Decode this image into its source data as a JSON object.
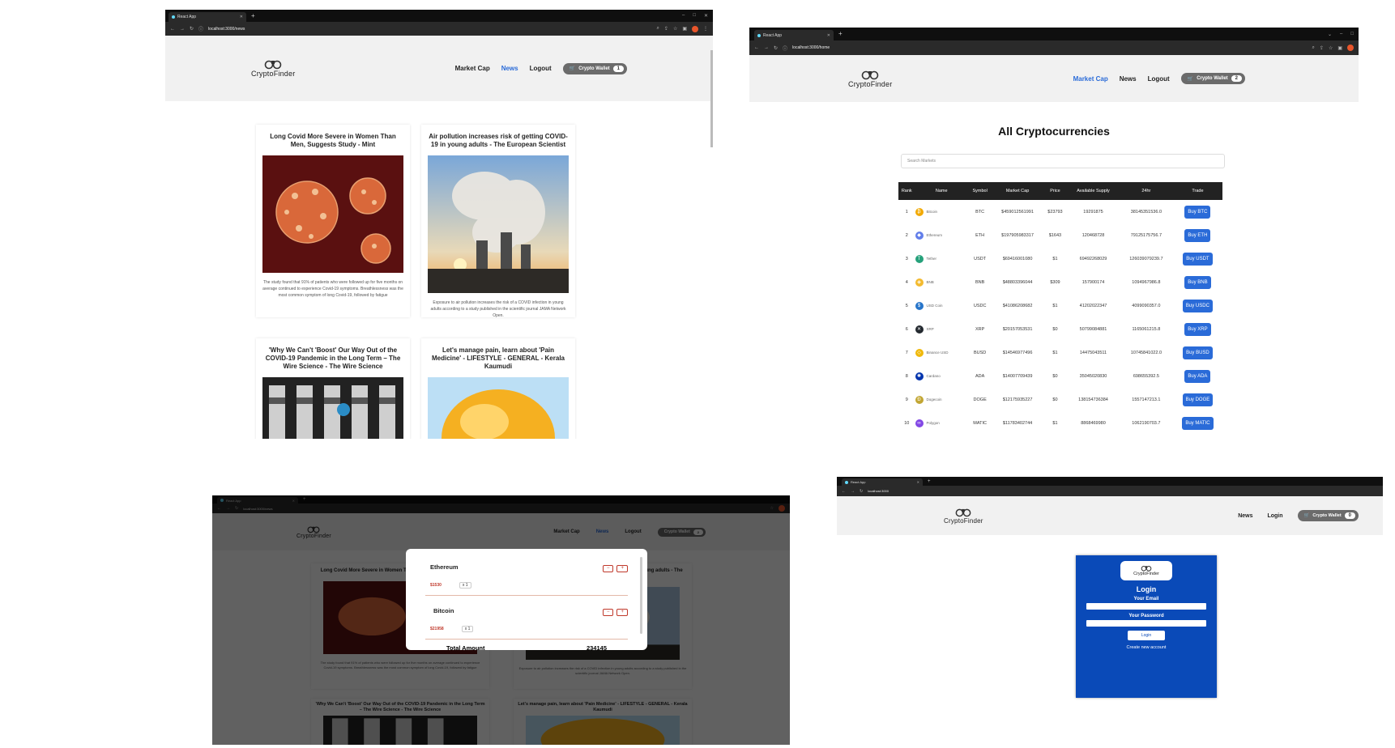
{
  "browser": {
    "tab_title": "React App",
    "news_url": "localhost:3000/news",
    "home_url": "localhost:3000/home",
    "login_url": "localhost:3000"
  },
  "brand": {
    "name": "CryptoFinder"
  },
  "nav": {
    "market_cap": "Market Cap",
    "news": "News",
    "logout": "Logout",
    "login": "Login",
    "wallet_label": "Crypto Wallet"
  },
  "wallet_counts": {
    "news": "1",
    "markets": "2",
    "login": "0"
  },
  "news": [
    {
      "title": "Long Covid More Severe in Women Than Men, Suggests Study - Mint",
      "desc": "The study found that 91% of patients who were followed up for five months on average continued to experience Covid-19 symptoms. Breathlessness was the most common symptom of long Covid-19, followed by fatigue"
    },
    {
      "title": "Air pollution increases risk of getting COVID-19 in young adults - The European Scientist",
      "desc": "Exposure to air pollution increases the risk of a COVID infection in young adults according to a study published in the scientific journal JAMA Network Open."
    },
    {
      "title": "'Why We Can't 'Boost' Our Way Out of the COVID-19 Pandemic in the Long Term – The Wire Science - The Wire Science",
      "desc": ""
    },
    {
      "title": "Let's manage pain, learn about 'Pain Medicine' - LIFESTYLE - GENERAL - Kerala Kaumudi",
      "desc": ""
    }
  ],
  "markets": {
    "title": "All Cryptocurrencies",
    "search_placeholder": "Search Markets",
    "headers": [
      "Rank",
      "Name",
      "Symbol",
      "Market Cap",
      "Price",
      "Available Supply",
      "24hr",
      "Trade"
    ],
    "rows": [
      {
        "rank": "1",
        "name": "Bitcoin",
        "symbol": "BTC",
        "cap": "$459012561991",
        "price": "$23793",
        "supply": "19291875",
        "vol": "38145351536.0",
        "trade": "Buy BTC",
        "color": "#f2a900",
        "glyph": "₿"
      },
      {
        "rank": "2",
        "name": "Ethereum",
        "symbol": "ETH",
        "cap": "$197905983317",
        "price": "$1643",
        "supply": "120468728",
        "vol": "79125175756.7",
        "trade": "Buy ETH",
        "color": "#627eea",
        "glyph": "◆"
      },
      {
        "rank": "3",
        "name": "Tether",
        "symbol": "USDT",
        "cap": "$69416001080",
        "price": "$1",
        "supply": "69492268029",
        "vol": "126039079239.7",
        "trade": "Buy USDT",
        "color": "#26a17b",
        "glyph": "T"
      },
      {
        "rank": "4",
        "name": "BNB",
        "symbol": "BNB",
        "cap": "$48803396044",
        "price": "$309",
        "supply": "157900174",
        "vol": "1094967986.8",
        "trade": "Buy BNB",
        "color": "#f3ba2f",
        "glyph": "◈"
      },
      {
        "rank": "5",
        "name": "USD Coin",
        "symbol": "USDC",
        "cap": "$41086208682",
        "price": "$1",
        "supply": "41202022347",
        "vol": "4099090357.0",
        "trade": "Buy USDC",
        "color": "#2775ca",
        "glyph": "$"
      },
      {
        "rank": "6",
        "name": "XRP",
        "symbol": "XRP",
        "cap": "$20157053531",
        "price": "$0",
        "supply": "50799084881",
        "vol": "1165061215.8",
        "trade": "Buy XRP",
        "color": "#23292f",
        "glyph": "✕"
      },
      {
        "rank": "7",
        "name": "Binance USD",
        "symbol": "BUSD",
        "cap": "$14546977496",
        "price": "$1",
        "supply": "14475043511",
        "vol": "10745841022.0",
        "trade": "Buy BUSD",
        "color": "#f0b90b",
        "glyph": "◇"
      },
      {
        "rank": "8",
        "name": "Cardano",
        "symbol": "ADA",
        "cap": "$14007709439",
        "price": "$0",
        "supply": "35045020830",
        "vol": "698655392.5",
        "trade": "Buy ADA",
        "color": "#0033ad",
        "glyph": "✺"
      },
      {
        "rank": "9",
        "name": "Dogecoin",
        "symbol": "DOGE",
        "cap": "$12175935227",
        "price": "$0",
        "supply": "138154736384",
        "vol": "1557147213.1",
        "trade": "Buy DOGE",
        "color": "#c2a633",
        "glyph": "Ð"
      },
      {
        "rank": "10",
        "name": "Polygon",
        "symbol": "MATIC",
        "cap": "$11783402744",
        "price": "$1",
        "supply": "8868469980",
        "vol": "1062190703.7",
        "trade": "Buy MATIC",
        "color": "#8247e5",
        "glyph": "∞"
      }
    ]
  },
  "cart": {
    "items": [
      {
        "name": "Ethereum",
        "price": "$1530",
        "qty": "x 1"
      },
      {
        "name": "Bitcoin",
        "price": "$21958",
        "qty": "x 1"
      }
    ],
    "total_label": "Total Amount",
    "total_value": "234145",
    "minus": "−",
    "plus": "+"
  },
  "login": {
    "title": "Login",
    "email_label": "Your Email",
    "password_label": "Your Password",
    "submit": "Login",
    "create_account": "Create new account"
  },
  "colors": {
    "accent": "#2a6bd8",
    "login_bg": "#0a4ab8",
    "price_red": "#c0392b"
  }
}
